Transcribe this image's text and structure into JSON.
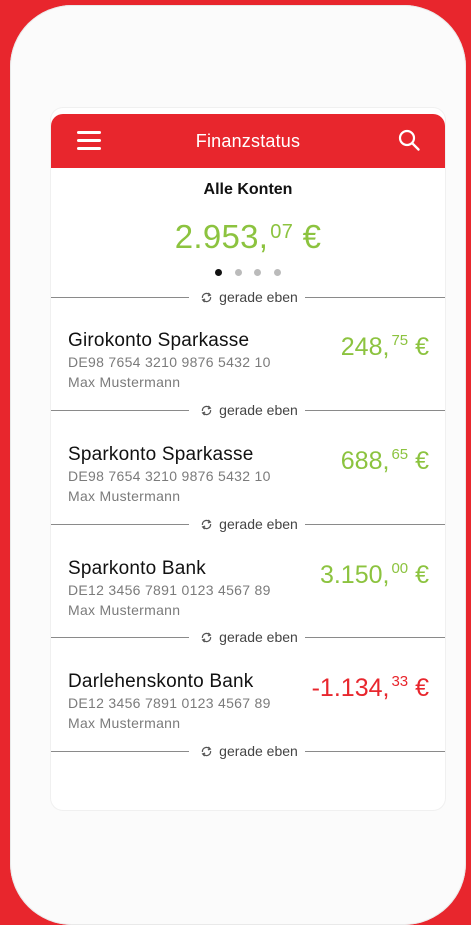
{
  "header": {
    "title": "Finanzstatus",
    "menu_icon": "hamburger-menu-icon",
    "search_icon": "search-icon"
  },
  "summary": {
    "label": "Alle Konten",
    "total_main": "2.953,",
    "total_cents": "07",
    "currency": "€",
    "page_indicator": {
      "count": 4,
      "active": 1
    }
  },
  "sync_label": "gerade eben",
  "accounts": [
    {
      "name": "Girokonto Sparkasse",
      "iban": "DE98 7654 3210 9876 5432 10",
      "owner": "Max Mustermann",
      "amount_main": "248,",
      "amount_cents": "75",
      "currency": "€"
    },
    {
      "name": "Sparkonto Sparkasse",
      "iban": "DE98 7654 3210 9876 5432 10",
      "owner": "Max Mustermann",
      "amount_main": "688,",
      "amount_cents": "65",
      "currency": "€"
    },
    {
      "name": "Sparkonto Bank",
      "iban": "DE12 3456 7891 0123 4567 89",
      "owner": "Max Mustermann",
      "amount_main": "3.150,",
      "amount_cents": "00",
      "currency": "€"
    },
    {
      "name": "Darlehenskonto Bank",
      "iban": "DE12 3456 7891 0123 4567 89",
      "owner": "Max Mustermann",
      "amount_main": "-1.134,",
      "amount_cents": "33",
      "currency": "€"
    }
  ],
  "colors": {
    "brand_red": "#e8262d",
    "positive_green": "#8cc33f",
    "negative_red": "#e8262d"
  }
}
